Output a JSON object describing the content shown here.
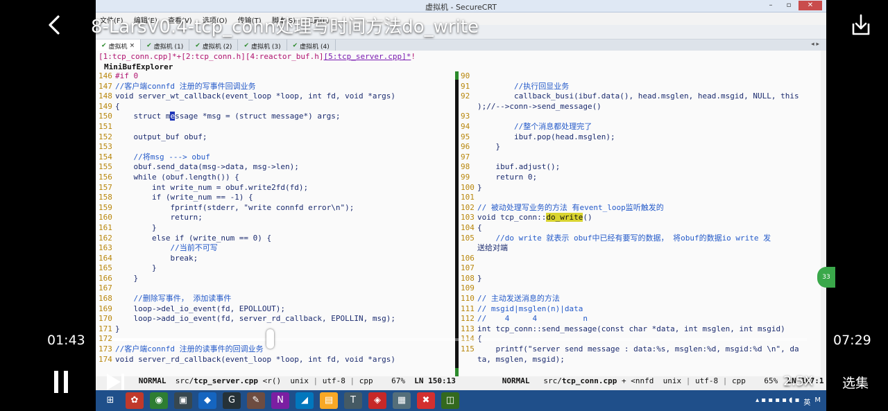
{
  "player": {
    "title": "8-LarsV0.4-tcp_conn处理写时间方法do_write",
    "time_current": "01:43",
    "time_total": "07:29",
    "progress": 0.229,
    "speed": "2.5X",
    "episodes_label": "选集",
    "float_badge": "33"
  },
  "window": {
    "title": "虚拟机 - SecureCRT",
    "controls": [
      "–",
      "▫",
      "✕"
    ],
    "menu": [
      "文件(F)",
      "编辑(E)",
      "查看(V)",
      "选项(O)",
      "传输(T)",
      "脚本(S)",
      "工具(L)"
    ],
    "tabs": [
      {
        "label": "虚拟机",
        "active": true
      },
      {
        "label": "虚拟机 (1)",
        "active": false
      },
      {
        "label": "虚拟机 (2)",
        "active": false
      },
      {
        "label": "虚拟机 (3)",
        "active": false
      },
      {
        "label": "虚拟机 (4)",
        "active": false
      }
    ],
    "tab_nav": "◂ ▸"
  },
  "editor": {
    "buffer_line_pre": "[1:tcp_conn.cpp]*+[2:tcp_conn.h][4:reactor_buf.h]",
    "buffer_line_cur": "[5:tcp_server.cpp]*",
    "buffer_line_post": "!",
    "explorer_title": "MiniBufExplorer",
    "left_pane": {
      "lines": [
        {
          "n": "146",
          "t": "#if 0"
        },
        {
          "n": "147",
          "t": "//客户端connfd 注册的写事件回调业务"
        },
        {
          "n": "148",
          "t": "void server_wt_callback(event_loop *loop, int fd, void *args)"
        },
        {
          "n": "149",
          "t": "{"
        },
        {
          "n": "150",
          "t_pre": "    struct m",
          "t_cursor": "e",
          "t_post": "ssage *msg = (struct message*) args;"
        },
        {
          "n": "151",
          "t": ""
        },
        {
          "n": "152",
          "t": "    output_buf obuf;"
        },
        {
          "n": "153",
          "t": ""
        },
        {
          "n": "154",
          "t": "    //将msg ---> obuf"
        },
        {
          "n": "155",
          "t": "    obuf.send_data(msg->data, msg->len);"
        },
        {
          "n": "156",
          "t": "    while (obuf.length()) {"
        },
        {
          "n": "157",
          "t": "        int write_num = obuf.write2fd(fd);"
        },
        {
          "n": "158",
          "t": "        if (write_num == -1) {"
        },
        {
          "n": "159",
          "t": "            fprintf(stderr, \"write connfd error\\n\");"
        },
        {
          "n": "160",
          "t": "            return;"
        },
        {
          "n": "161",
          "t": "        }"
        },
        {
          "n": "162",
          "t": "        else if (write_num == 0) {"
        },
        {
          "n": "163",
          "t": "            //当前不可写"
        },
        {
          "n": "164",
          "t": "            break;"
        },
        {
          "n": "165",
          "t": "        }"
        },
        {
          "n": "166",
          "t": "    }"
        },
        {
          "n": "167",
          "t": ""
        },
        {
          "n": "168",
          "t": "    //删除写事件， 添加读事件"
        },
        {
          "n": "169",
          "t": "    loop->del_io_event(fd, EPOLLOUT);"
        },
        {
          "n": "170",
          "t": "    loop->add_io_event(fd, server_rd_callback, EPOLLIN, msg);"
        },
        {
          "n": "171",
          "t": "}"
        },
        {
          "n": "172",
          "t": ""
        },
        {
          "n": "173",
          "t": "//客户端connfd 注册的读事件的回调业务"
        },
        {
          "n": "174",
          "t": "void server_rd_callback(event_loop *loop, int fd, void *args)"
        }
      ],
      "status": {
        "mode": "NORMAL",
        "file_pre": "src/",
        "file_name": "tcp_server.cpp",
        "extra": "<r()",
        "format": "unix",
        "encoding": "utf-8",
        "filetype": "cpp",
        "percent": "67%",
        "position": "LN 150:13"
      }
    },
    "right_pane": {
      "lines": [
        {
          "n": "90",
          "t": ""
        },
        {
          "n": "91",
          "t": "        //执行回显业务"
        },
        {
          "n": "92",
          "t": "        callback_busi(ibuf.data(), head.msglen, head.msgid, NULL, this"
        },
        {
          "n": "",
          "t": ");//-->conn->send_message()"
        },
        {
          "n": "93",
          "t": ""
        },
        {
          "n": "94",
          "t": "        //整个消息都处理完了"
        },
        {
          "n": "95",
          "t": "        ibuf.pop(head.msglen);"
        },
        {
          "n": "96",
          "t": "    }"
        },
        {
          "n": "97",
          "t": ""
        },
        {
          "n": "98",
          "t": "    ibuf.adjust();"
        },
        {
          "n": "99",
          "t": "    return 0;"
        },
        {
          "n": "100",
          "t": "}"
        },
        {
          "n": "101",
          "t": ""
        },
        {
          "n": "102",
          "t": "// 被动处理写业务的方法 有event_loop监听触发的"
        },
        {
          "n": "103",
          "t_pre": "void tcp_conn::",
          "t_hl": "do_write",
          "t_post": "()"
        },
        {
          "n": "104",
          "t": "{"
        },
        {
          "n": "105",
          "t": "    //do write 就表示 obuf中已经有要写的数据， 将obuf的数据io write 发"
        },
        {
          "n": "",
          "t": "送给对端"
        },
        {
          "n": "106",
          "t": ""
        },
        {
          "n": "107",
          "t": ""
        },
        {
          "n": "108",
          "t": "}"
        },
        {
          "n": "109",
          "t": ""
        },
        {
          "n": "110",
          "t": "// 主动发送消息的方法"
        },
        {
          "n": "111",
          "t": "// msgid|msglen(n)|data"
        },
        {
          "n": "112",
          "t": "//    4     4          n"
        },
        {
          "n": "113",
          "t": "int tcp_conn::send_message(const char *data, int msglen, int msgid)"
        },
        {
          "n": "114",
          "t": "{"
        },
        {
          "n": "115",
          "t": "    printf(\"server send message : data:%s, msglen:%d, msgid:%d \\n\", da"
        },
        {
          "n": "",
          "t": "ta, msglen, msgid);"
        }
      ],
      "status": {
        "mode": "NORMAL",
        "file_pre": "src/",
        "file_name": "tcp_conn.cpp",
        "extra": "+ <nnfd",
        "format": "unix",
        "encoding": "utf-8",
        "filetype": "cpp",
        "percent": "65%",
        "position": "LN 107:1"
      }
    }
  },
  "taskbar": {
    "icons": [
      "start-icon",
      "pinwheel-icon",
      "chrome-icon",
      "computer-icon",
      "vscode-icon",
      "goland-icon",
      "paint-icon",
      "onenote-icon",
      "sharkfin-icon",
      "folder-icon",
      "typora-icon",
      "fish-icon",
      "securecrt-icon",
      "xmind-icon",
      "virtualbox-icon"
    ],
    "tray_lang": "英",
    "tray_m": "M"
  },
  "colors": {
    "player_text": "#ffffff",
    "comment": "#245ac9",
    "code": "#1a2a6e",
    "preproc": "#b0126f",
    "linenum": "#b8860b",
    "highlight": "#d9d430",
    "taskbar": "#1f4f8a"
  }
}
